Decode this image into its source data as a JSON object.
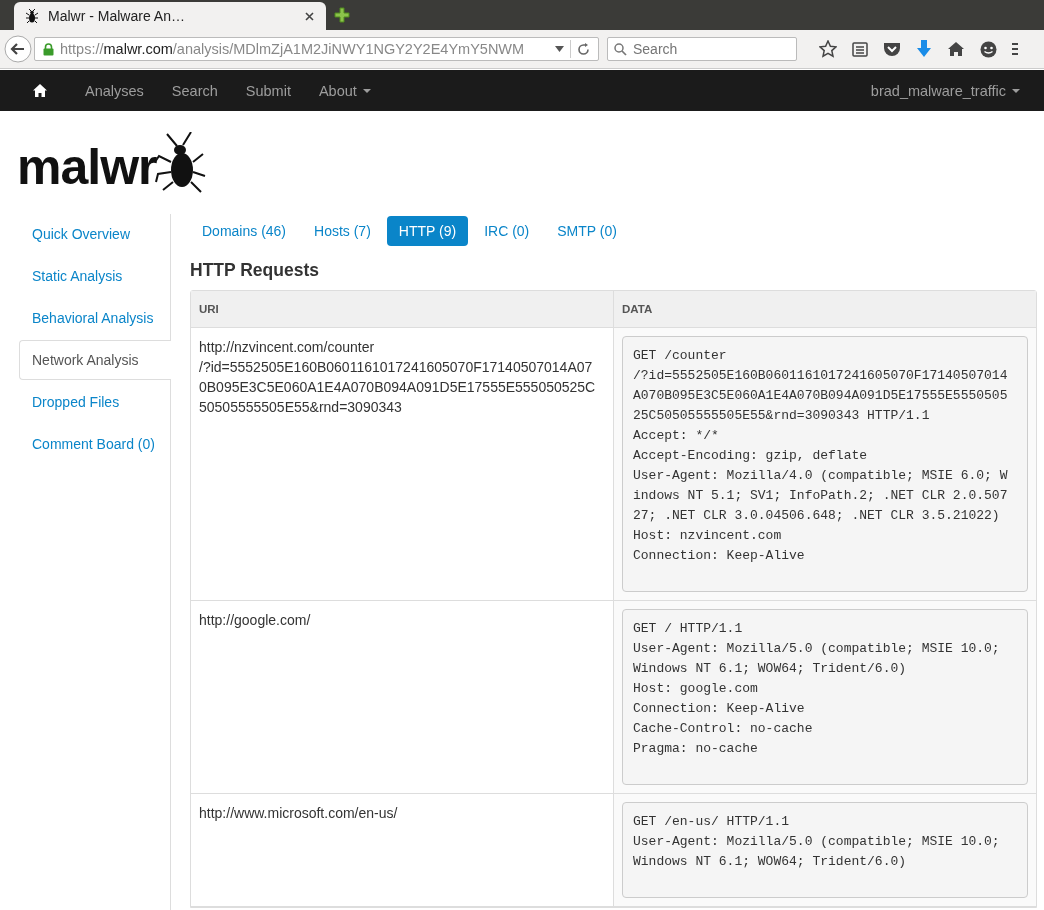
{
  "browser": {
    "tab_title": "Malwr - Malware An…",
    "url_scheme": "https://",
    "url_host": "malwr.com",
    "url_path": "/analysis/MDlmZjA1M2JiNWY1NGY2Y2E4YmY5NWM",
    "search": {
      "placeholder": "Search"
    }
  },
  "navbar": {
    "items": [
      {
        "label": "Analyses",
        "dropdown": false
      },
      {
        "label": "Search",
        "dropdown": false
      },
      {
        "label": "Submit",
        "dropdown": false
      },
      {
        "label": "About",
        "dropdown": true
      }
    ],
    "user": "brad_malware_traffic"
  },
  "logo": "malwr",
  "sidebar": {
    "items": [
      {
        "label": "Quick Overview",
        "selected": false
      },
      {
        "label": "Static Analysis",
        "selected": false
      },
      {
        "label": "Behavioral Analysis",
        "selected": false
      },
      {
        "label": "Network Analysis",
        "selected": true
      },
      {
        "label": "Dropped Files",
        "selected": false
      },
      {
        "label": "Comment Board (0)",
        "selected": false
      }
    ]
  },
  "tabs": [
    {
      "label": "Domains (46)",
      "selected": false
    },
    {
      "label": "Hosts (7)",
      "selected": false
    },
    {
      "label": "HTTP (9)",
      "selected": true
    },
    {
      "label": "IRC (0)",
      "selected": false
    },
    {
      "label": "SMTP (0)",
      "selected": false
    }
  ],
  "section_title": "HTTP Requests",
  "table": {
    "columns": [
      "URI",
      "DATA"
    ],
    "rows": [
      {
        "uri": [
          "http://nzvincent.com/counter",
          "/?id=5552505E160B0601161017241605070F17140507014A07",
          "0B095E3C5E060A1E4A070B094A091D5E17555E555050525C",
          "50505555505E55&rnd=3090343"
        ],
        "data": [
          "GET /counter",
          "/?id=5552505E160B0601161017241605070F17140507014",
          "A070B095E3C5E060A1E4A070B094A091D5E17555E5550505",
          "25C50505555505E55&rnd=3090343 HTTP/1.1",
          "Accept: */*",
          "Accept-Encoding: gzip, deflate",
          "User-Agent: Mozilla/4.0 (compatible; MSIE 6.0; W",
          "indows NT 5.1; SV1; InfoPath.2; .NET CLR 2.0.507",
          "27; .NET CLR 3.0.04506.648; .NET CLR 3.5.21022)",
          "Host: nzvincent.com",
          "Connection: Keep-Alive"
        ]
      },
      {
        "uri": [
          "http://google.com/"
        ],
        "data": [
          "GET / HTTP/1.1",
          "User-Agent: Mozilla/5.0 (compatible; MSIE 10.0;",
          "Windows NT 6.1; WOW64; Trident/6.0)",
          "Host: google.com",
          "Connection: Keep-Alive",
          "Cache-Control: no-cache",
          "Pragma: no-cache"
        ]
      },
      {
        "uri": [
          "http://www.microsoft.com/en-us/"
        ],
        "data": [
          "GET /en-us/ HTTP/1.1",
          "User-Agent: Mozilla/5.0 (compatible; MSIE 10.0;",
          "Windows NT 6.1; WOW64; Trident/6.0)"
        ]
      }
    ]
  }
}
